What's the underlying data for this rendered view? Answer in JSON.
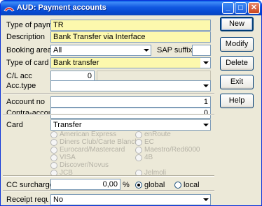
{
  "window": {
    "title": "AUD: Payment accounts"
  },
  "form": {
    "type_of_payment": {
      "label": "Type of payment",
      "value": "TR"
    },
    "description": {
      "label": "Description",
      "value": "Bank Transfer via Interface"
    },
    "booking_area": {
      "label": "Booking area",
      "value": "All"
    },
    "sap_suffix": {
      "label": "SAP suffix",
      "value": ""
    },
    "type_of_card": {
      "label": "Type of card",
      "value": "Bank transfer"
    },
    "cl_acc": {
      "label": "C/L acc",
      "value": "0"
    },
    "acc_type": {
      "label": "Acc.type",
      "value": ""
    },
    "account_no": {
      "label": "Account no",
      "value": "1"
    },
    "contra_account": {
      "label": "Contra-account",
      "value": "0"
    },
    "card": {
      "label": "Card",
      "value": "Transfer"
    },
    "card_options_left": [
      "American Express",
      "Diners Club/Carte Blanche",
      "Eurocard/Mastercard",
      "VISA",
      "Discover/Novus",
      "JCB"
    ],
    "card_options_right": [
      "enRoute",
      "EC",
      "Maestro/Red6000",
      "4B",
      "",
      "Jelmoli"
    ],
    "cc_surcharge": {
      "label": "CC surcharge",
      "value": "0,00",
      "unit": "%"
    },
    "scope": {
      "global": "global",
      "local": "local",
      "selected": "global"
    },
    "receipt_required": {
      "label": "Receipt require",
      "value": "No"
    }
  },
  "buttons": {
    "new": "New",
    "modify": "Modify",
    "delete": "Delete",
    "exit": "Exit",
    "help": "Help"
  },
  "colors": {
    "required_field": "#fcf8ad",
    "titlebar": "#0548d0",
    "window_bg": "#ece9d8"
  },
  "icons": {
    "app": "red-app-icon",
    "minimize": "minimize-icon",
    "maximize": "maximize-icon",
    "close": "close-icon"
  }
}
